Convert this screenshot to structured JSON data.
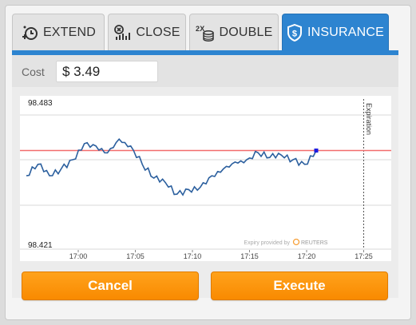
{
  "tabs": [
    {
      "label": "EXTEND",
      "icon": "clock-plus-icon",
      "active": false
    },
    {
      "label": "CLOSE",
      "icon": "close-chart-icon",
      "active": false
    },
    {
      "label": "DOUBLE",
      "icon": "double-coins-icon",
      "icon_text": "2X",
      "active": false
    },
    {
      "label": "INSURANCE",
      "icon": "shield-dollar-icon",
      "active": true
    }
  ],
  "cost": {
    "label": "Cost",
    "value": "$ 3.49"
  },
  "chart": {
    "y_top_label": "98.483",
    "y_bottom_label": "98.421",
    "x_ticks": [
      "17:00",
      "17:05",
      "17:10",
      "17:15",
      "17:20",
      "17:25"
    ],
    "expiration_label": "Expiration",
    "provider_text": "Expiry provided by",
    "provider_brand": "REUTERS"
  },
  "chart_data": {
    "type": "line",
    "ylim": [
      98.421,
      98.483
    ],
    "x": [
      "16:57",
      "16:57",
      "16:58",
      "16:59",
      "17:00",
      "17:01",
      "17:02",
      "17:03",
      "17:04",
      "17:05",
      "17:06",
      "17:07",
      "17:08",
      "17:09",
      "17:10",
      "17:11",
      "17:12",
      "17:13",
      "17:14",
      "17:15",
      "17:16",
      "17:17",
      "17:18",
      "17:19",
      "17:20",
      "17:21"
    ],
    "values": [
      98.453,
      98.458,
      98.453,
      98.456,
      98.46,
      98.467,
      98.466,
      98.463,
      98.469,
      98.466,
      98.458,
      98.452,
      98.45,
      98.445,
      98.447,
      98.448,
      98.453,
      98.456,
      98.459,
      98.46,
      98.463,
      98.461,
      98.462,
      98.46,
      98.458,
      98.464
    ],
    "threshold": 98.464,
    "threshold_color": "#f26c6c",
    "line_color": "#2b5f9e",
    "expiration_x": "17:25"
  },
  "buttons": {
    "cancel": "Cancel",
    "execute": "Execute"
  }
}
